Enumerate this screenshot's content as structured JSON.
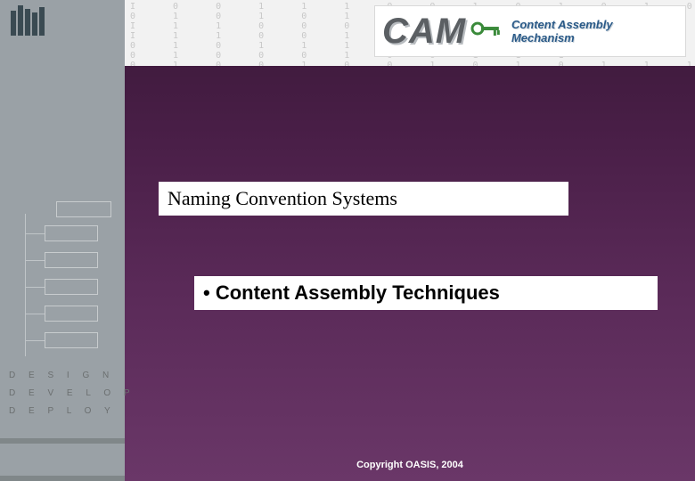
{
  "sidebar": {
    "words": [
      "D E S I G N",
      "D E V E L O P",
      "D E P L O Y"
    ]
  },
  "header": {
    "binary": "I  0  0  1  1  1  0  0  1  0  1  0  1  0  0  0  1  0  0  0  1  0  0  1  1\n0  1  0  1  0  1  1  0  0  1\nI  1  1  0  0  0  I  I  1  0  0\nI  1  1  0  0  1  0  1  0  1  0\n0  1  0  1  1  1  0  0  1  1  1\n0  1  0  0  0  1  0  0  1  1  1\n0  1  0  0  1  0  0  1  0  1  0  1  1  1  0  0  1  1  1  0  0  0  1  1  1",
    "cam_acronym": "CAM",
    "cam_full": "Content Assembly Mechanism"
  },
  "slide": {
    "title": "Naming Convention Systems",
    "bullet": "• Content Assembly Techniques"
  },
  "footer": {
    "copyright": "Copyright OASIS, 2004"
  }
}
